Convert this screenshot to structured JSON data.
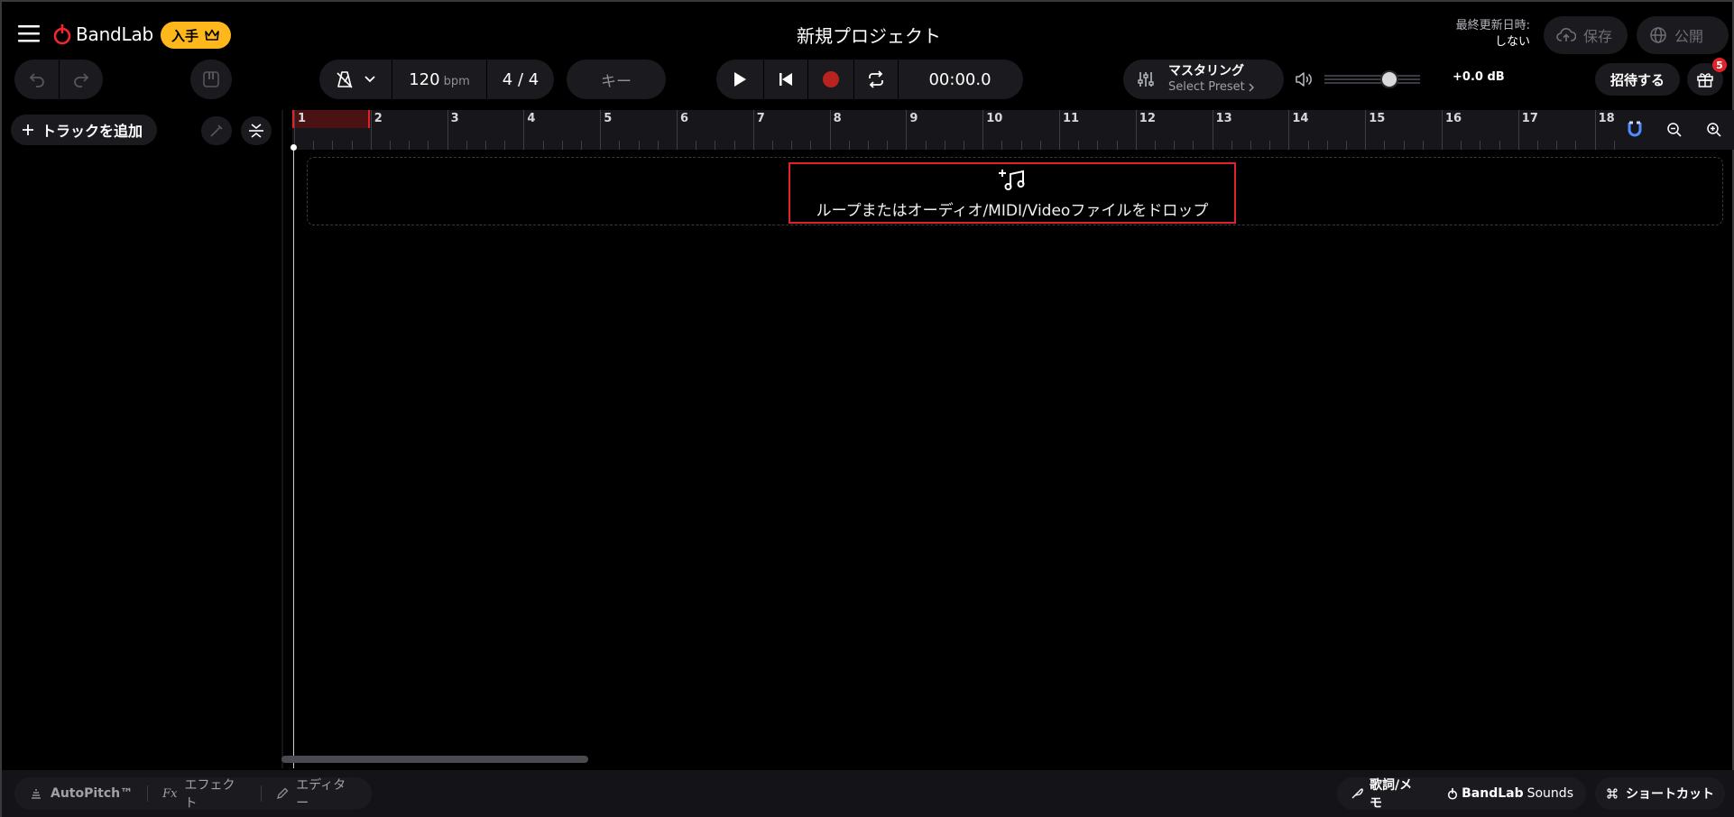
{
  "header": {
    "logo_text": "BandLab",
    "get_pro_label": "入手",
    "project_title": "新規プロジェクト",
    "last_saved_label": "最終更新日時:",
    "last_saved_value": "しない",
    "save_label": "保存",
    "publish_label": "公開"
  },
  "toolbar": {
    "tempo_value": "120",
    "tempo_unit": "bpm",
    "time_signature": "4 / 4",
    "key_label": "キー",
    "time_display": "00:00.0",
    "mastering_label": "マスタリング",
    "mastering_preset": "Select Preset",
    "volume_db": "+0.0 dB",
    "volume_level": 0.68,
    "invite_label": "招待する",
    "gift_badge_count": "5"
  },
  "tracks": {
    "add_track_label": "トラックを追加"
  },
  "ruler": {
    "bars": [
      "1",
      "2",
      "3",
      "4",
      "5",
      "6",
      "7",
      "8",
      "9",
      "10",
      "11",
      "12",
      "13",
      "14",
      "15",
      "16",
      "17",
      "18"
    ]
  },
  "drop_zone": {
    "text": "ループまたはオーディオ/MIDI/Videoファイルをドロップ"
  },
  "bottom_bar": {
    "autopitch_label": "AutoPitch™",
    "effects_label": "エフェクト",
    "editor_label": "エディター",
    "lyrics_label": "歌詞/メモ",
    "sounds_brand": "BandLab",
    "sounds_label": "Sounds",
    "shortcut_label": "ショートカット"
  },
  "colors": {
    "accent_red": "#e0222a",
    "pro_yellow": "#ffb81c",
    "magnet_blue": "#4f8cff",
    "record_red": "#b8231f"
  }
}
